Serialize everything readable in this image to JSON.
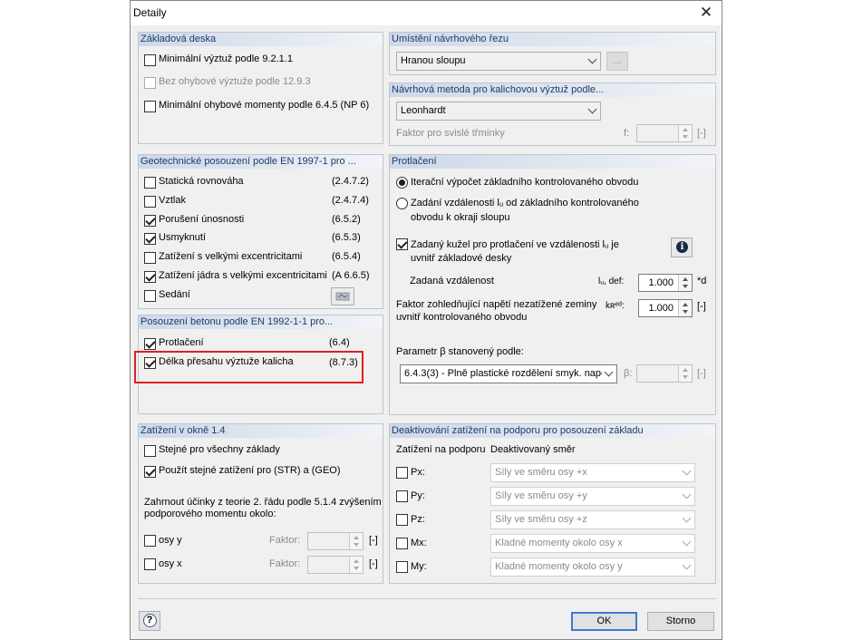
{
  "window": {
    "title": "Detaily",
    "close_glyph": "✕"
  },
  "zakladova_deska": {
    "header": "Základová deska",
    "items": [
      {
        "label": "Minimální výztuž podle 9.2.1.1",
        "checked": false,
        "enabled": true
      },
      {
        "label": "Bez ohybové výztuže podle 12.9.3",
        "checked": false,
        "enabled": false
      },
      {
        "label": "Minimální ohybové momenty podle 6.4.5 (NP 6)",
        "checked": false,
        "enabled": true
      }
    ]
  },
  "geotech": {
    "header": "Geotechnické posouzení podle EN 1997-1 pro ...",
    "items": [
      {
        "label": "Statická rovnováha",
        "code": "(2.4.7.2)",
        "checked": false
      },
      {
        "label": "Vztlak",
        "code": "(2.4.7.4)",
        "checked": false
      },
      {
        "label": "Porušení únosnosti",
        "code": "(6.5.2)",
        "checked": true
      },
      {
        "label": "Usmyknutí",
        "code": "(6.5.3)",
        "checked": true
      },
      {
        "label": "Zatížení s velkými excentricitami",
        "code": "(6.5.4)",
        "checked": false
      },
      {
        "label": "Zatížení jádra s velkými excentricitami",
        "code": "(A 6.6.5)",
        "checked": true
      },
      {
        "label": "Sedání",
        "code": "",
        "checked": false
      }
    ]
  },
  "beton": {
    "header": "Posouzení betonu podle EN 1992-1-1 pro...",
    "items": [
      {
        "label": "Protlačení",
        "code": "(6.4)",
        "checked": true
      },
      {
        "label": "Délka přesahu výztuže kalicha",
        "code": "(8.7.3)",
        "checked": true
      }
    ]
  },
  "zatizeni": {
    "header": "Zatížení v okně 1.4",
    "items": [
      {
        "label": "Stejné pro všechny základy",
        "checked": false
      },
      {
        "label": "Použít stejné zatížení pro (STR) a (GEO)",
        "checked": true
      }
    ],
    "teorie_text_1": "Zahrnout účinky z teorie 2. řádu podle 5.1.4 zvýšením",
    "teorie_text_2": "podporového momentu okolo:",
    "axes": [
      {
        "label": "osy y",
        "faktor_label": "Faktor:",
        "unit": "[-]",
        "value": ""
      },
      {
        "label": "osy x",
        "faktor_label": "Faktor:",
        "unit": "[-]",
        "value": ""
      }
    ]
  },
  "umisteni": {
    "header": "Umístění návrhového řezu",
    "selected": "Hranou sloupu",
    "ellipsis": "..."
  },
  "navrhova": {
    "header": "Návrhová metoda pro kalichovou výztuž podle...",
    "selected": "Leonhardt",
    "faktor_label": "Faktor pro svislé třmínky",
    "f_label": "f:",
    "unit": "[-]",
    "value": ""
  },
  "protlaceni": {
    "header": "Protlačení",
    "radio1": "Iterační výpočet základního kontrolovaného obvodu",
    "radio2_line1": "Zadání vzdálenosti lᵤ od základního kontrolovaného",
    "radio2_line2": "obvodu k okraji sloupu",
    "radio_selected": 1,
    "kuzel_line1": "Zadaný kužel pro protlačení ve vzdálenosti lᵤ je",
    "kuzel_line2": "uvnitř základové desky",
    "kuzel_checked": true,
    "zadana_label": "Zadaná vzdálenost",
    "zadana_sym": "lᵤ, def:",
    "zadana_value": "1.000",
    "zadana_unit": "*d",
    "faktor_line1": "Faktor zohledňující napětí nezatížené zeminy",
    "faktor_line2": "uvnitř kontrolovaného obvodu",
    "faktor_sym": "kʀᵉᵈ:",
    "faktor_value": "1.000",
    "faktor_unit": "[-]",
    "param_label": "Parametr β stanovený podle:",
    "param_selected": "6.4.3(3) - Plně plastické rozdělení smyk. napě",
    "beta_label": "β:",
    "beta_unit": "[-]"
  },
  "deaktivovani": {
    "header": "Deaktivování zatížení na podporu pro posouzení základu",
    "col1": "Zatížení na podporu",
    "col2": "Deaktivovaný směr",
    "rows": [
      {
        "label": "Px:",
        "value": "Síly ve směru osy +x",
        "checked": false
      },
      {
        "label": "Py:",
        "value": "Síly ve směru osy +y",
        "checked": false
      },
      {
        "label": "Pz:",
        "value": "Síly ve směru osy +z",
        "checked": false
      },
      {
        "label": "Mx:",
        "value": "Kladné momenty okolo osy x",
        "checked": false
      },
      {
        "label": "My:",
        "value": "Kladné momenty okolo osy y",
        "checked": false
      }
    ]
  },
  "footer": {
    "ok": "OK",
    "cancel": "Storno",
    "help_glyph": "?"
  }
}
